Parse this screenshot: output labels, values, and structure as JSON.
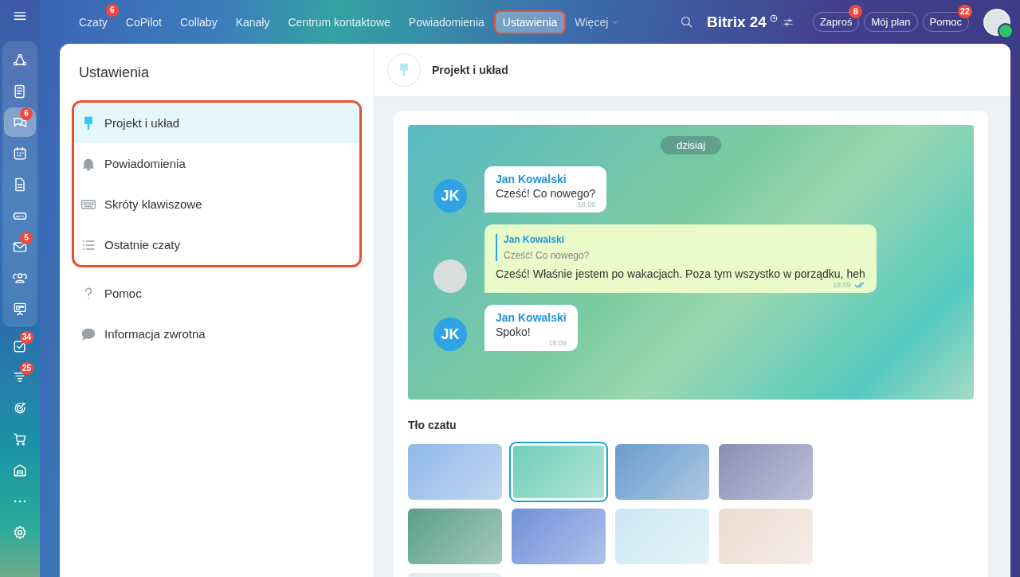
{
  "top_nav": {
    "items": [
      {
        "label": "Czaty",
        "selected": false,
        "highlighted": false,
        "badge": "6"
      },
      {
        "label": "CoPilot",
        "selected": false,
        "highlighted": false
      },
      {
        "label": "Collaby",
        "selected": false,
        "highlighted": false
      },
      {
        "label": "Kanały",
        "selected": false,
        "highlighted": false
      },
      {
        "label": "Centrum kontaktowe",
        "selected": false,
        "highlighted": false
      },
      {
        "label": "Powiadomienia",
        "selected": false,
        "highlighted": false
      },
      {
        "label": "Ustawienia",
        "selected": true,
        "highlighted": true
      }
    ],
    "more": "Więcej",
    "logo": {
      "name": "Bitrix",
      "number": "24"
    },
    "buttons": [
      {
        "label": "Zaproś",
        "badge": "8"
      },
      {
        "label": "Mój plan"
      },
      {
        "label": "Pomoc",
        "badge": "22"
      }
    ]
  },
  "left_rail": {
    "groups": [
      {
        "panel": true,
        "items": [
          {
            "kind": "route",
            "selected": false
          },
          {
            "kind": "news",
            "selected": false
          },
          {
            "kind": "chat",
            "selected": true,
            "badge": "6"
          },
          {
            "kind": "calendar",
            "selected": false
          },
          {
            "kind": "doc",
            "selected": false
          },
          {
            "kind": "drive",
            "selected": false
          },
          {
            "kind": "mail",
            "selected": false,
            "badge": "5"
          },
          {
            "kind": "people",
            "selected": false
          },
          {
            "kind": "board",
            "selected": false
          }
        ]
      },
      {
        "panel": false,
        "items": [
          {
            "kind": "tasks",
            "selected": false,
            "badge": "34"
          },
          {
            "kind": "funnel",
            "selected": false,
            "badge": "25"
          },
          {
            "kind": "target",
            "selected": false
          },
          {
            "kind": "cart",
            "selected": false
          },
          {
            "kind": "store",
            "selected": false
          },
          {
            "kind": "more",
            "selected": false
          },
          {
            "kind": "gear",
            "selected": false
          }
        ]
      }
    ]
  },
  "settings": {
    "title": "Ustawienia",
    "groups": [
      {
        "highlighted": true,
        "items": [
          {
            "kind": "brush",
            "label": "Projekt i układ",
            "selected": true
          },
          {
            "kind": "bell",
            "label": "Powiadomienia",
            "selected": false
          },
          {
            "kind": "keyboard",
            "label": "Skróty klawiszowe",
            "selected": false
          },
          {
            "kind": "list",
            "label": "Ostatnie czaty",
            "selected": false
          }
        ]
      },
      {
        "highlighted": false,
        "items": [
          {
            "kind": "question",
            "label": "Pomoc",
            "selected": false
          },
          {
            "kind": "comment",
            "label": "Informacja zwrotna",
            "selected": false
          }
        ]
      }
    ]
  },
  "content": {
    "title": "Projekt i układ",
    "preview": {
      "date": "dzisiaj",
      "messages": [
        {
          "kind": "incoming",
          "author": "Jan Kowalski",
          "initials": "JK",
          "text": "Cześć! Co nowego?",
          "time": "18:09"
        },
        {
          "kind": "outgoing",
          "quote_author": "Jan Kowalski",
          "quote_text": "Cześć! Co nowego?",
          "text": "Cześć! Właśnie jestem po wakacjach. Poza tym wszystko w porządku, heh",
          "time": "18:09",
          "read": true
        },
        {
          "kind": "incoming",
          "author": "Jan Kowalski",
          "initials": "JK",
          "text": "Spoko!",
          "time": "18:09"
        }
      ]
    },
    "backgrounds": {
      "title": "Tło czatu",
      "items": [
        {
          "color": "#8fb8e8",
          "selected": false
        },
        {
          "color": "#6fcfb8",
          "selected": true
        },
        {
          "color": "#6a9ccc",
          "selected": false
        },
        {
          "color": "#8890b8",
          "selected": false
        },
        {
          "color": "#5a9e8a",
          "selected": false
        },
        {
          "color": "#7090d8",
          "selected": false
        },
        {
          "color": "#cce8f4",
          "selected": false
        },
        {
          "color": "#eedcd0",
          "selected": false
        },
        {
          "color": "#e4ecf0",
          "selected": false
        }
      ]
    }
  }
}
